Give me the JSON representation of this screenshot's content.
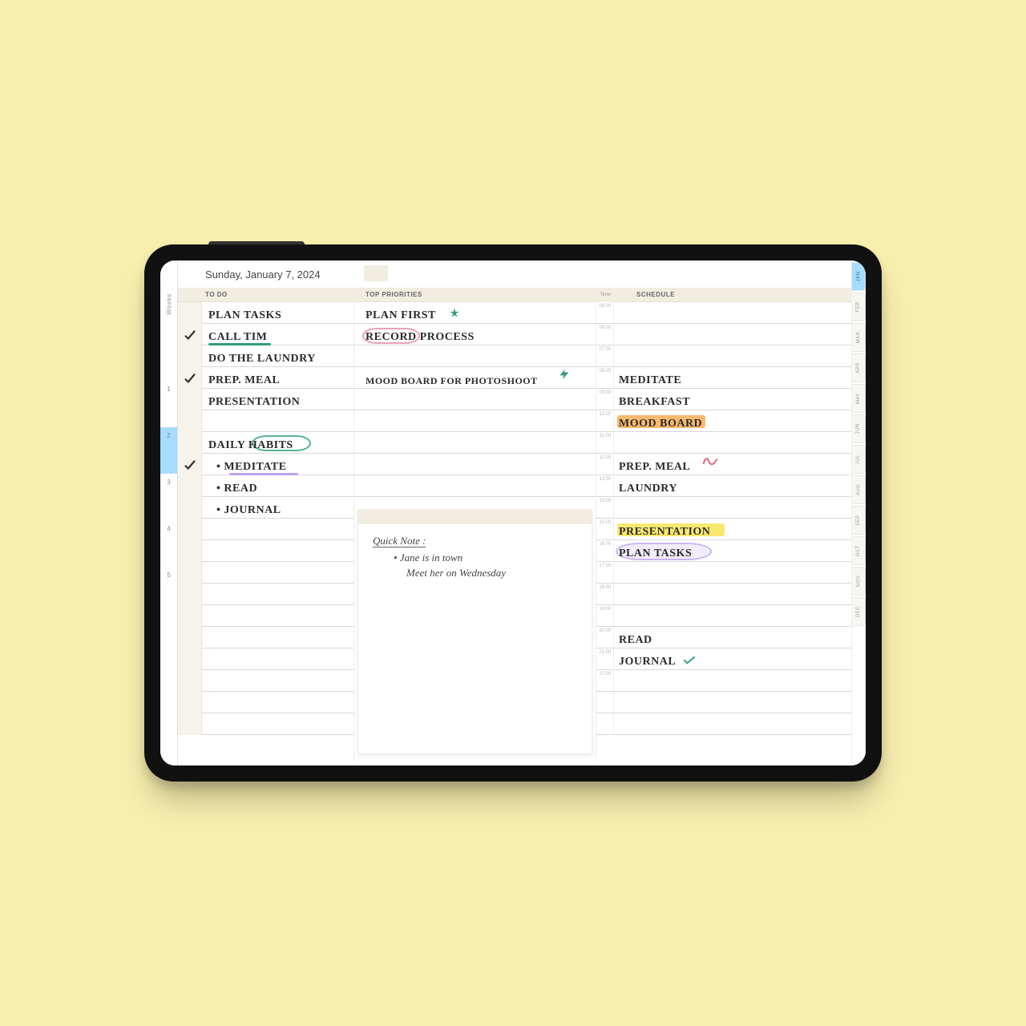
{
  "date": "Sunday, January 7, 2024",
  "weeks_label": "Weeks",
  "week_numbers": [
    "1",
    "2",
    "3",
    "4",
    "5"
  ],
  "active_week_index": 1,
  "months": [
    "JAN",
    "FEB",
    "MAR",
    "APR",
    "MAY",
    "JUN",
    "JUL",
    "AUG",
    "SEP",
    "OCT",
    "NOV",
    "DEC"
  ],
  "active_month_index": 0,
  "headers": {
    "todo": "TO DO",
    "priorities": "TOP PRIORITIES",
    "schedule": "SCHEDULE",
    "time": "Time"
  },
  "todo": {
    "items": [
      {
        "text": "PLAN TASKS",
        "checked": false
      },
      {
        "text": "CALL TIM",
        "checked": true,
        "underline": "green"
      },
      {
        "text": "DO THE LAUNDRY",
        "checked": false
      },
      {
        "text": "PREP. MEAL",
        "checked": true
      },
      {
        "text": "PRESENTATION",
        "checked": false
      }
    ],
    "habits_title": "DAILY HABITS",
    "habits": [
      {
        "text": "MEDITATE",
        "checked": true,
        "underline": "purple"
      },
      {
        "text": "READ",
        "checked": false
      },
      {
        "text": "JOURNAL",
        "checked": false
      }
    ]
  },
  "priorities": [
    {
      "text": "PLAN FIRST",
      "mark": "star"
    },
    {
      "text": "RECORD PROCESS",
      "circle": "pink",
      "circle_word": "RECORD"
    },
    {
      "text": "MOOD BOARD FOR PHOTOSHOOT",
      "mark": "bolt"
    }
  ],
  "quick_note": {
    "title": "Quick Note :",
    "lines": [
      "• Jane is in town",
      "Meet her on Wednesday"
    ]
  },
  "schedule_times": [
    "05:00",
    "06:00",
    "07:00",
    "08:00",
    "09:00",
    "10:00",
    "11:00",
    "12:00",
    "13:00",
    "14:00",
    "15:00",
    "16:00",
    "17:00",
    "18:00",
    "19:00",
    "20:00",
    "21:00",
    "22:00"
  ],
  "schedule": [
    {
      "row": 3,
      "text": "MEDITATE"
    },
    {
      "row": 4,
      "text": "BREAKFAST"
    },
    {
      "row": 5,
      "text": "MOOD BOARD",
      "hl": "orange"
    },
    {
      "row": 8,
      "text": "PREP. MEAL",
      "mark": "squiggle"
    },
    {
      "row": 9,
      "text": "LAUNDRY"
    },
    {
      "row": 11,
      "text": "PRESENTATION",
      "hl": "yellow"
    },
    {
      "row": 12,
      "text": "PLAN TASKS",
      "circle": "purple"
    },
    {
      "row": 15,
      "text": "READ"
    },
    {
      "row": 16,
      "text": "JOURNAL",
      "mark": "tick"
    }
  ]
}
